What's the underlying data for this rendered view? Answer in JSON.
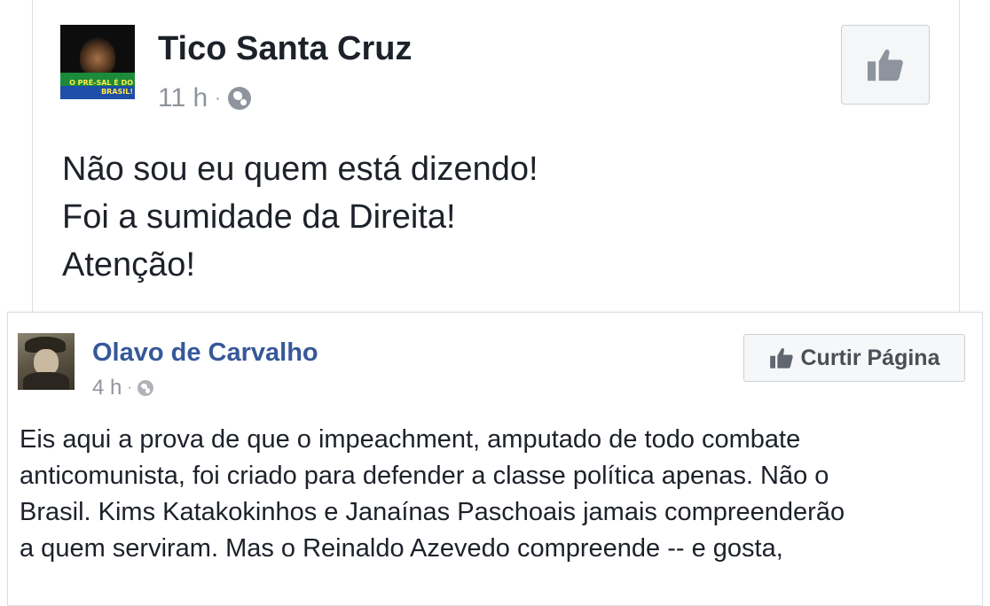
{
  "shared_post": {
    "author": "Tico Santa Cruz",
    "avatar_text": [
      "O PRÉ-SAL É DO",
      "BRASIL!"
    ],
    "time": "11 h",
    "separator": "·",
    "privacy_icon": "globe-icon",
    "like_icon": "thumbs-up-icon",
    "text_lines": [
      "Não sou eu quem está dizendo!",
      "Foi a sumidade da Direita!",
      "Atenção!"
    ]
  },
  "original_post": {
    "author": "Olavo de Carvalho",
    "time": "4 h",
    "separator": "·",
    "privacy_icon": "globe-icon",
    "like_page_label": "Curtir Página",
    "like_icon": "thumbs-up-icon",
    "text_lines": [
      "Eis aqui a prova de que o impeachment, amputado de todo combate",
      "anticomunista, foi criado para defender a classe política apenas. Não o",
      "Brasil. Kims Katakokinhos e Janaínas Paschoais jamais compreenderão",
      "a quem serviram. Mas o Reinaldo Azevedo compreende -- e gosta,"
    ]
  },
  "colors": {
    "author_link": "#365899",
    "meta_gray": "#90949c",
    "text": "#1d2129",
    "icon_gray": "#606770"
  }
}
